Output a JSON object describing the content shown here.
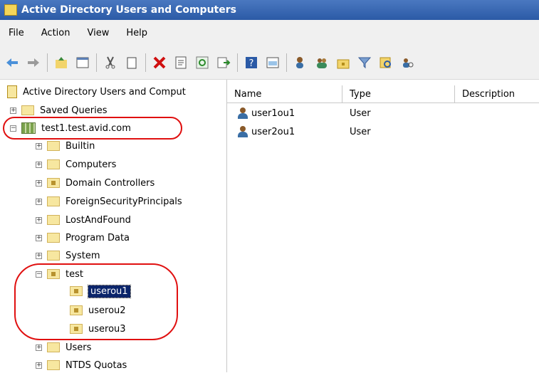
{
  "window": {
    "title": "Active Directory Users and Computers"
  },
  "menu": [
    "File",
    "Action",
    "View",
    "Help"
  ],
  "tree": {
    "root": "Active Directory Users and Comput",
    "saved_queries": "Saved Queries",
    "domain": "test1.test.avid.com",
    "containers": [
      "Builtin",
      "Computers",
      "Domain Controllers",
      "ForeignSecurityPrincipals",
      "LostAndFound",
      "Program Data",
      "System"
    ],
    "test_ou": "test",
    "children": [
      "userou1",
      "userou2",
      "userou3"
    ],
    "after": [
      "Users",
      "NTDS Quotas"
    ]
  },
  "list": {
    "columns": [
      "Name",
      "Type",
      "Description"
    ],
    "rows": [
      {
        "name": "user1ou1",
        "type": "User"
      },
      {
        "name": "user2ou1",
        "type": "User"
      }
    ]
  },
  "colors": {
    "titlebar": "#2b5aa6",
    "highlight_circle": "#e01010",
    "selection": "#0a246a"
  }
}
